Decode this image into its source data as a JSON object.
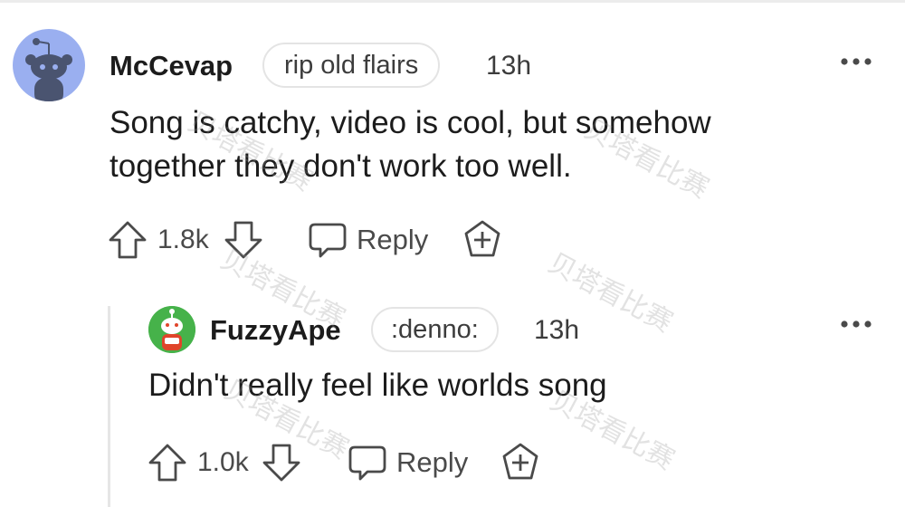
{
  "comments": [
    {
      "author": "McCevap",
      "flair": "rip old flairs",
      "time": "13h",
      "body": "Song is catchy, video is cool, but somehow together they don't work too well.",
      "votes": "1.8k",
      "reply_label": "Reply",
      "avatar_color": "#9aaff0"
    },
    {
      "author": "FuzzyApe",
      "flair": ":denno:",
      "time": "13h",
      "body": "Didn't really feel like worlds song",
      "votes": "1.0k",
      "reply_label": "Reply",
      "avatar_color": "#46b24a"
    }
  ],
  "watermark": "贝塔看比赛",
  "icons": {
    "upvote": "arrow-up-outline",
    "downvote": "arrow-down-outline",
    "reply": "speech-bubble",
    "award": "plus-pentagon",
    "more": "three-dots"
  },
  "colors": {
    "text": "#1c1c1c",
    "meta": "#4a4a4a",
    "border": "#e4e4e4"
  }
}
